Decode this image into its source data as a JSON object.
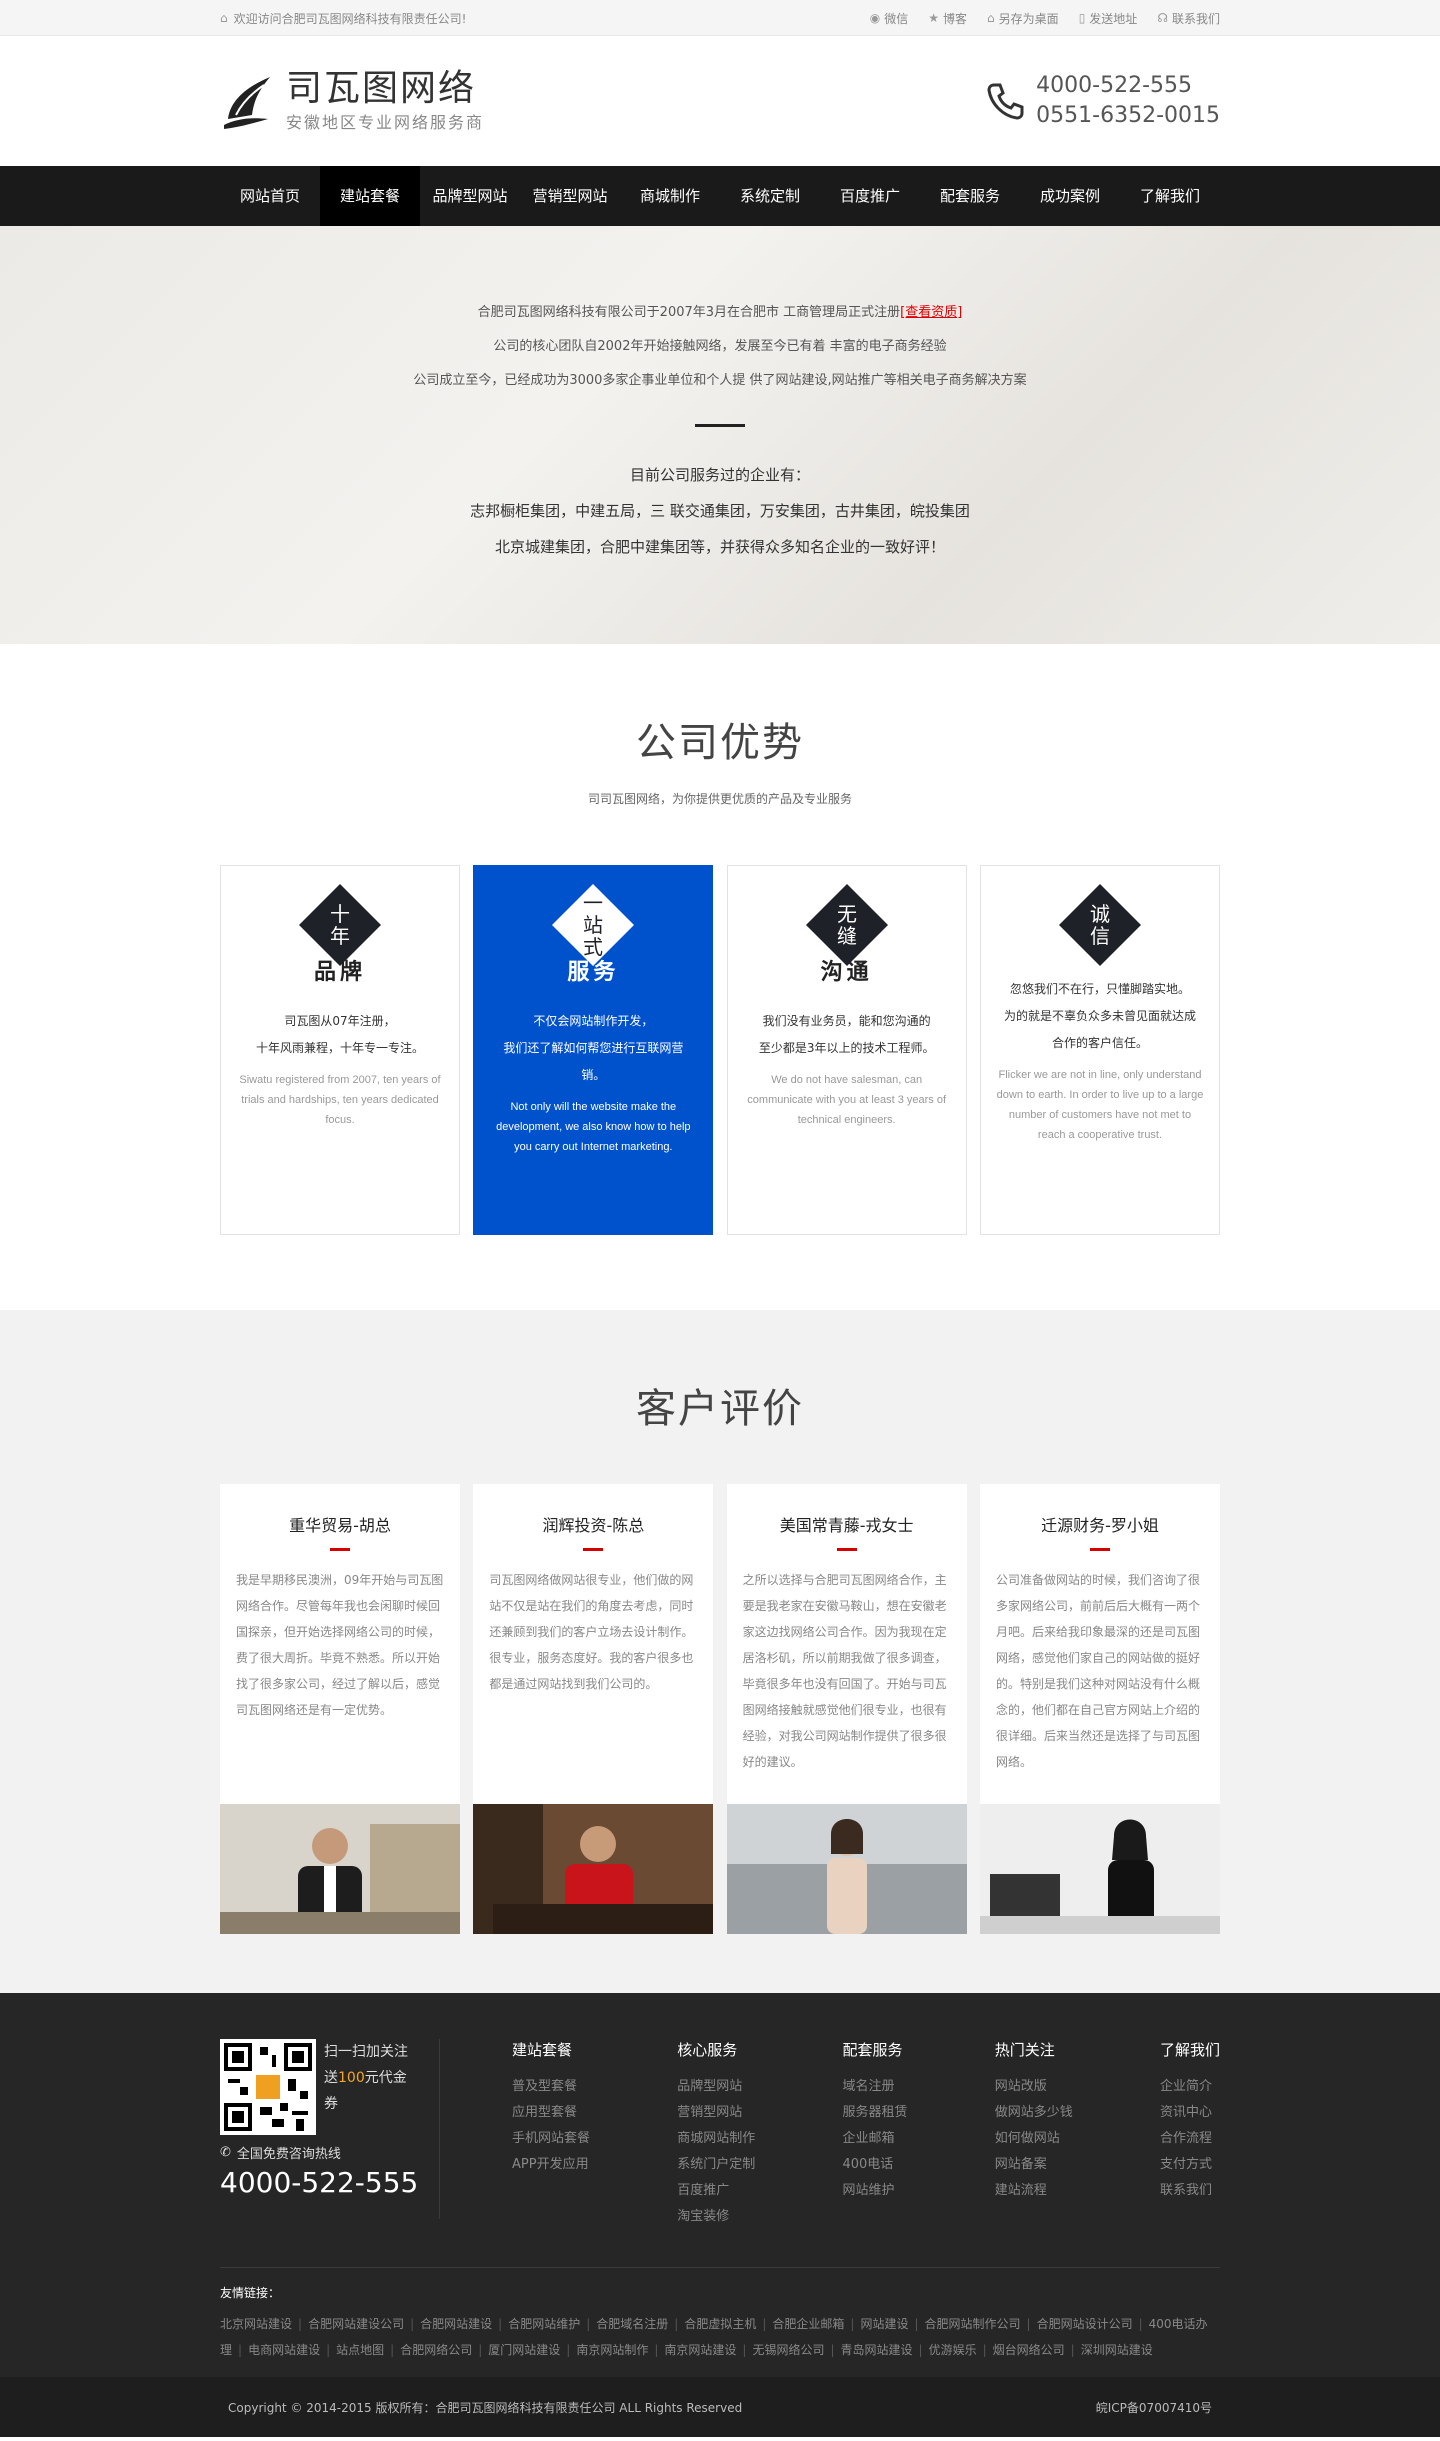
{
  "topbar": {
    "welcome": "欢迎访问合肥司瓦图网络科技有限责任公司!",
    "links": [
      "微信",
      "博客",
      "另存为桌面",
      "发送地址",
      "联系我们"
    ]
  },
  "header": {
    "logo_title": "司瓦图网络",
    "logo_sub": "安徽地区专业网络服务商",
    "phone1": "4000-522-555",
    "phone2": "0551-6352-0015"
  },
  "nav": [
    "网站首页",
    "建站套餐",
    "品牌型网站",
    "营销型网站",
    "商城制作",
    "系统定制",
    "百度推广",
    "配套服务",
    "成功案例",
    "了解我们"
  ],
  "intro": {
    "line1_a": "合肥司瓦图网络科技有限公司于2007年3月在合肥市 工商管理局正式注册",
    "line1_link": "[查看资质]",
    "line2": "公司的核心团队自2002年开始接触网络，发展至今已有着 丰富的电子商务经验",
    "line3": "公司成立至今，已经成功为3000多家企事业单位和个人提 供了网站建设,网站推广等相关电子商务解决方案",
    "clients_title": "目前公司服务过的企业有：",
    "clients1": "志邦橱柜集团，中建五局，三 联交通集团，万安集团，古井集团，皖投集团",
    "clients2": "北京城建集团，合肥中建集团等，并获得众多知名企业的一致好评！"
  },
  "advantages": {
    "title": "公司优势",
    "subtitle": "司司瓦图网络，为你提供更优质的产品及专业服务",
    "cards": [
      {
        "badge": "十年",
        "title": "品牌",
        "cn1": "司瓦图从07年注册，",
        "cn2": "十年风雨兼程，十年专一专注。",
        "en": "Siwatu registered from 2007, ten years of trials and hardships, ten years dedicated focus."
      },
      {
        "badge": "一站式",
        "title": "服务",
        "cn1": "不仅会网站制作开发，",
        "cn2": "我们还了解如何帮您进行互联网营销。",
        "en": "Not only will the website make the development, we also know how to help you carry out Internet marketing."
      },
      {
        "badge": "无缝",
        "title": "沟通",
        "cn1": "我们没有业务员，能和您沟通的",
        "cn2": "至少都是3年以上的技术工程师。",
        "en": "We do not have salesman, can communicate with you at least 3 years of technical engineers."
      },
      {
        "badge": "诚信",
        "title": "",
        "cn1": "忽悠我们不在行，只懂脚踏实地。",
        "cn2": "为的就是不辜负众多未曾见面就达成合作的客户信任。",
        "en": "Flicker we are not in line, only understand down to earth. In order to live up to a large number of customers have not met to reach a cooperative trust."
      }
    ]
  },
  "reviews": {
    "title": "客户评价",
    "cards": [
      {
        "name": "重华贸易-胡总",
        "text": "我是早期移民澳洲，09年开始与司瓦图网络合作。尽管每年我也会闲聊时候回国探亲，但开始选择网络公司的时候，费了很大周折。毕竟不熟悉。所以开始找了很多家公司，经过了解以后，感觉司瓦图网络还是有一定优势。"
      },
      {
        "name": "润辉投资-陈总",
        "text": "司瓦图网络做网站很专业，他们做的网站不仅是站在我们的角度去考虑，同时还兼顾到我们的客户立场去设计制作。很专业，服务态度好。我的客户很多也都是通过网站找到我们公司的。"
      },
      {
        "name": "美国常青藤-戎女士",
        "text": "之所以选择与合肥司瓦图网络合作，主要是我老家在安徽马鞍山，想在安徽老家这边找网络公司合作。因为我现在定居洛杉矶，所以前期我做了很多调查，毕竟很多年也没有回国了。开始与司瓦图网络接触就感觉他们很专业，也很有经验，对我公司网站制作提供了很多很好的建议。"
      },
      {
        "name": "迁源财务-罗小姐",
        "text": "公司准备做网站的时候，我们咨询了很多家网络公司，前前后后大概有一两个月吧。后来给我印象最深的还是司瓦图网络，感觉他们家自己的网站做的挺好的。特别是我们这种对网站没有什么概念的，他们都在自己官方网站上介绍的很详细。后来当然还是选择了与司瓦图网络。"
      }
    ]
  },
  "footer": {
    "qr_text_a": "扫一扫加关注 送",
    "qr_text_em": "100",
    "qr_text_b": "元代金券",
    "freecall": "全国免费咨询热线",
    "hotline": "4000-522-555",
    "cols": [
      {
        "title": "建站套餐",
        "items": [
          "普及型套餐",
          "应用型套餐",
          "手机网站套餐",
          "APP开发应用"
        ]
      },
      {
        "title": "核心服务",
        "items": [
          "品牌型网站",
          "营销型网站",
          "商城网站制作",
          "系统门户定制",
          "百度推广",
          "淘宝装修"
        ]
      },
      {
        "title": "配套服务",
        "items": [
          "域名注册",
          "服务器租赁",
          "企业邮箱",
          "400电话",
          "网站维护"
        ]
      },
      {
        "title": "热门关注",
        "items": [
          "网站改版",
          "做网站多少钱",
          "如何做网站",
          "网站备案",
          "建站流程"
        ]
      },
      {
        "title": "了解我们",
        "items": [
          "企业简介",
          "资讯中心",
          "合作流程",
          "支付方式",
          "联系我们"
        ]
      }
    ],
    "links_title": "友情链接：",
    "links": [
      "北京网站建设",
      "合肥网站建设公司",
      "合肥网站建设",
      "合肥网站维护",
      "合肥域名注册",
      "合肥虚拟主机",
      "合肥企业邮箱",
      "网站建设",
      "合肥网站制作公司",
      "合肥网站设计公司",
      "400电话办理",
      "电商网站建设",
      "站点地图",
      "合肥网络公司",
      "厦门网站建设",
      "南京网站制作",
      "南京网站建设",
      "无锡网络公司",
      "青岛网站建设",
      "优游娱乐",
      "烟台网络公司",
      "深圳网站建设"
    ],
    "copyright": "Copyright © 2014-2015 版权所有：合肥司瓦图网络科技有限责任公司  ALL Rights Reserved",
    "icp": "皖ICP备07007410号"
  }
}
